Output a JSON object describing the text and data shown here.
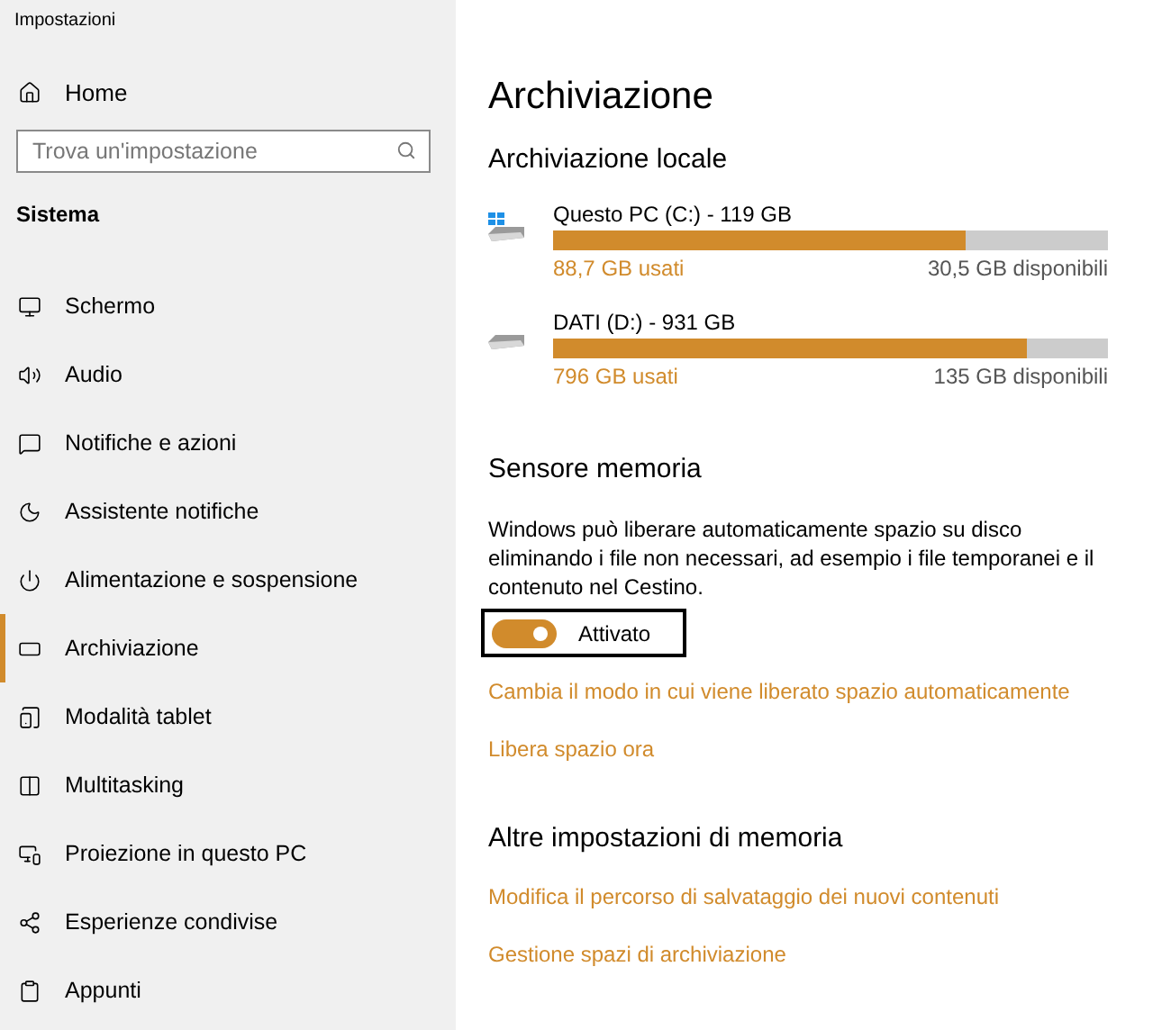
{
  "window": {
    "title": "Impostazioni"
  },
  "sidebar": {
    "home": "Home",
    "search": {
      "placeholder": "Trova un'impostazione"
    },
    "section": "Sistema",
    "items": [
      {
        "label": "Schermo",
        "selected": false
      },
      {
        "label": "Audio",
        "selected": false
      },
      {
        "label": "Notifiche e azioni",
        "selected": false
      },
      {
        "label": "Assistente notifiche",
        "selected": false
      },
      {
        "label": "Alimentazione e sospensione",
        "selected": false
      },
      {
        "label": "Archiviazione",
        "selected": true
      },
      {
        "label": "Modalità tablet",
        "selected": false
      },
      {
        "label": "Multitasking",
        "selected": false
      },
      {
        "label": "Proiezione in questo PC",
        "selected": false
      },
      {
        "label": "Esperienze condivise",
        "selected": false
      },
      {
        "label": "Appunti",
        "selected": false
      }
    ]
  },
  "main": {
    "title": "Archiviazione",
    "local_heading": "Archiviazione locale",
    "drives": [
      {
        "kind": "system",
        "name": "Questo PC (C:) - 119 GB",
        "level": 0.745,
        "used": "88,7 GB usati",
        "free": "30,5 GB disponibili"
      },
      {
        "kind": "data",
        "name": "DATI (D:) - 931 GB",
        "level": 0.855,
        "used": "796 GB usati",
        "free": "135 GB disponibili"
      }
    ],
    "sense_heading": "Sensore memoria",
    "sense_text": "Windows può liberare automaticamente spazio su disco eliminando i file non necessari, ad esempio i file temporanei e il contenuto nel Cestino.",
    "toggle": {
      "on": true,
      "label": "Attivato"
    },
    "sense_links": [
      "Cambia il modo in cui viene liberato spazio automaticamente",
      "Libera spazio ora"
    ],
    "other_heading": "Altre impostazioni di memoria",
    "other_links": [
      "Modifica il percorso di salvataggio dei nuovi contenuti",
      "Gestione spazi di archiviazione"
    ]
  }
}
